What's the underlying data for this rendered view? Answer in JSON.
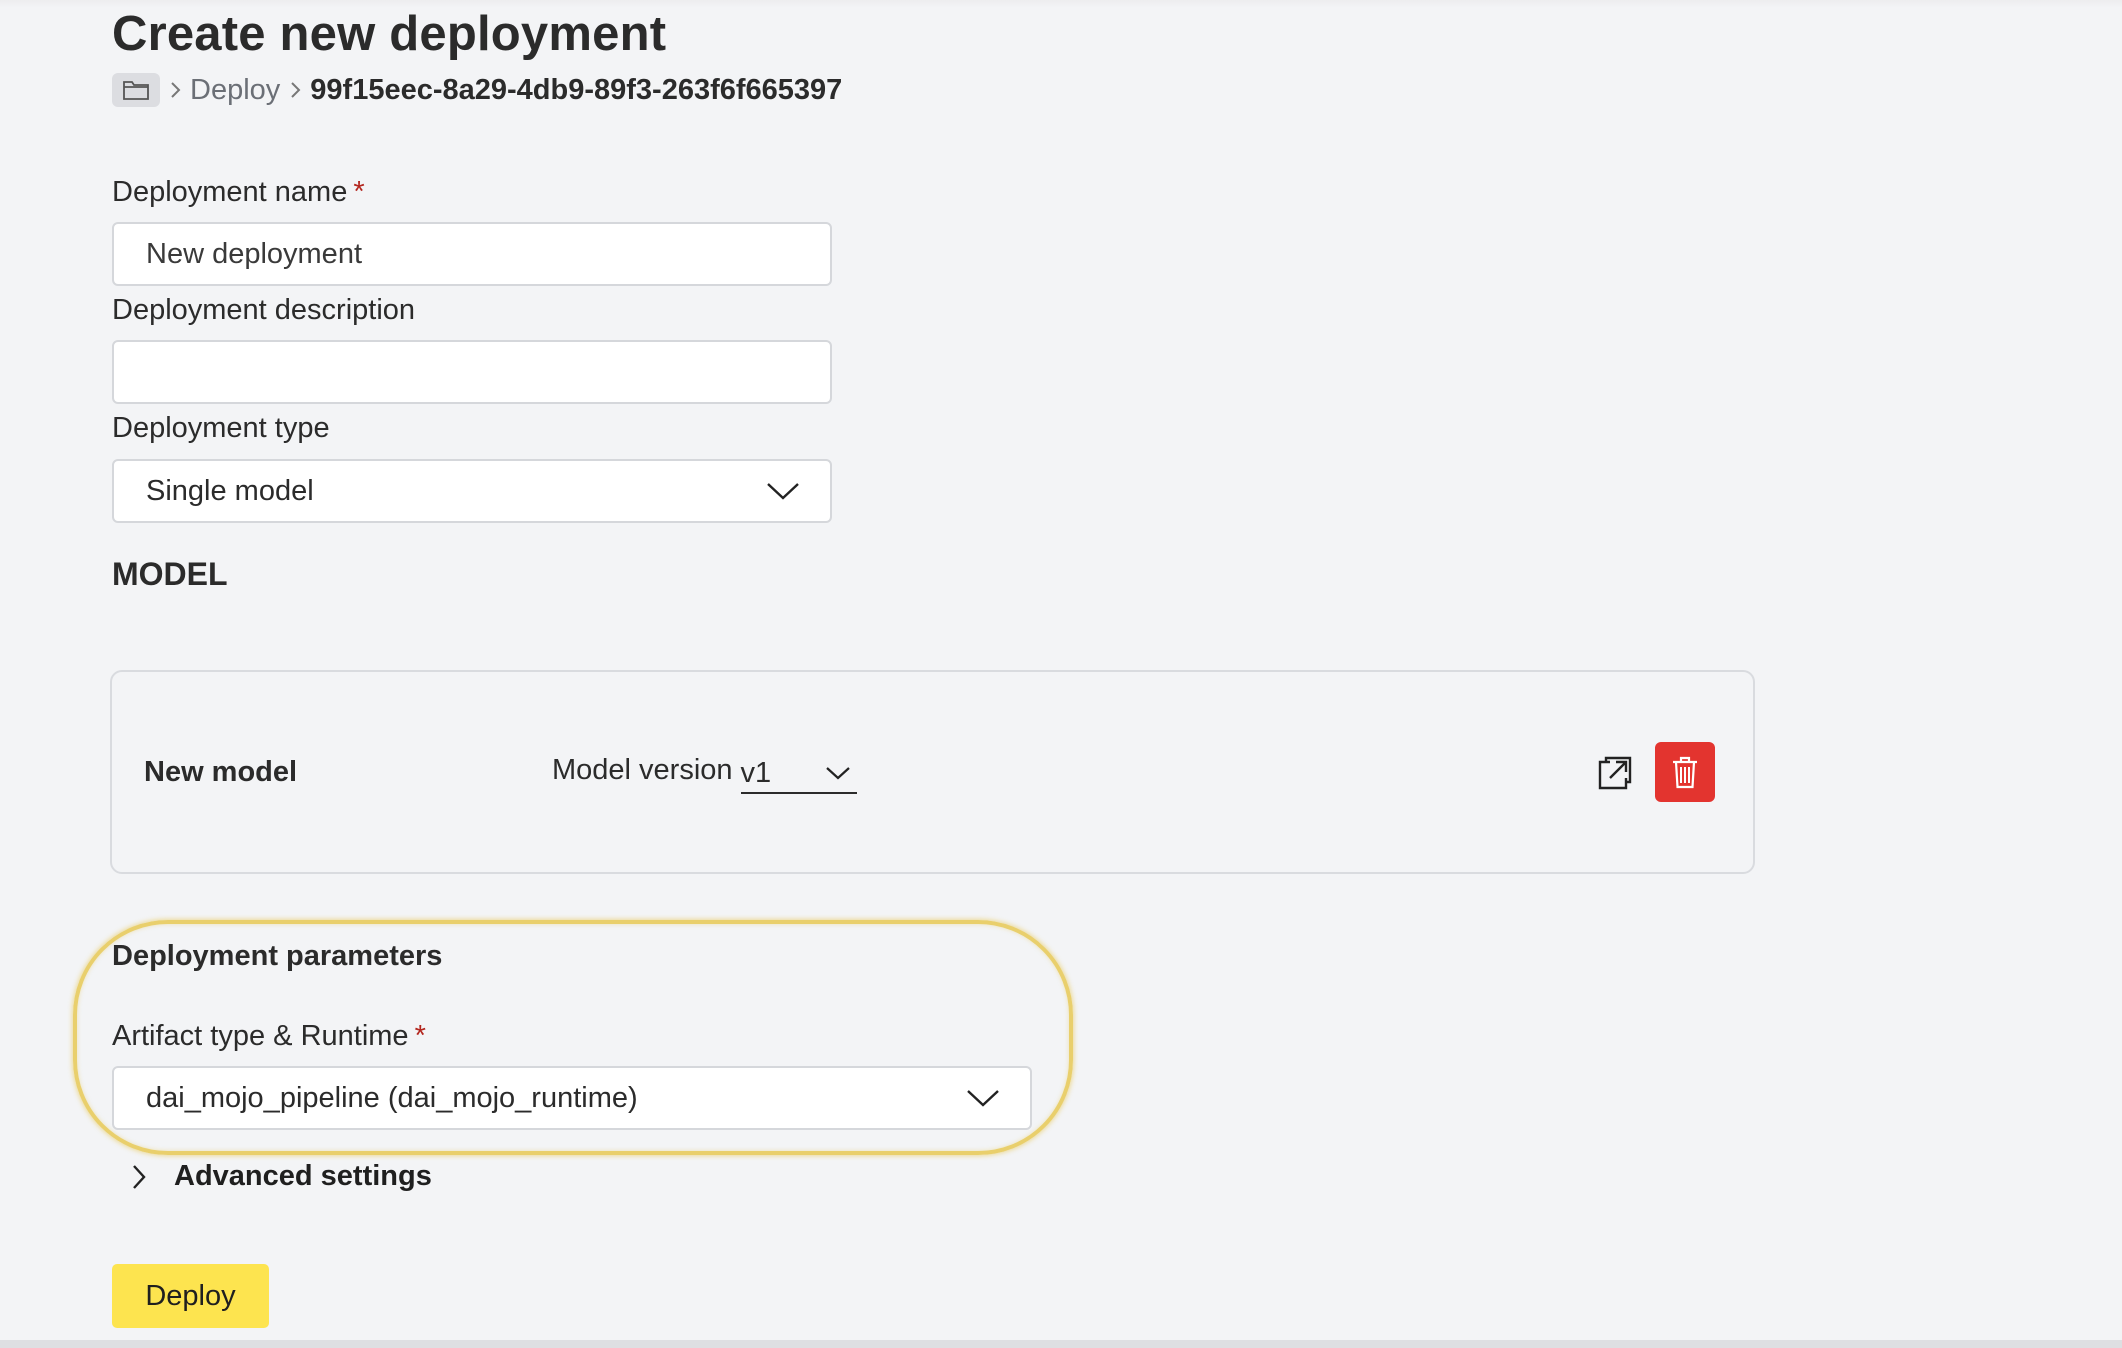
{
  "page": {
    "title": "Create new deployment"
  },
  "breadcrumb": {
    "home_icon": "folder-icon",
    "items": [
      "Deploy",
      "99f15eec-8a29-4db9-89f3-263f6f665397"
    ]
  },
  "form": {
    "name_label": "Deployment name",
    "required_marker": "*",
    "name_value": "New deployment",
    "description_label": "Deployment description",
    "description_value": "",
    "type_label": "Deployment type",
    "type_value": "Single model"
  },
  "model_section": {
    "heading": "MODEL",
    "model_name": "New model",
    "version_label": "Model version",
    "version_value": "v1",
    "open_icon": "open-external-icon",
    "delete_icon": "trash-icon"
  },
  "params": {
    "heading": "Deployment parameters",
    "artifact_label": "Artifact type & Runtime",
    "artifact_value": "dai_mojo_pipeline (dai_mojo_runtime)"
  },
  "advanced": {
    "label": "Advanced settings"
  },
  "actions": {
    "deploy_label": "Deploy"
  },
  "colors": {
    "background": "#f3f4f6",
    "primary_button": "#fde44f",
    "danger": "#e3342f",
    "required": "#b3261e",
    "highlight": "#e9cf6c"
  }
}
